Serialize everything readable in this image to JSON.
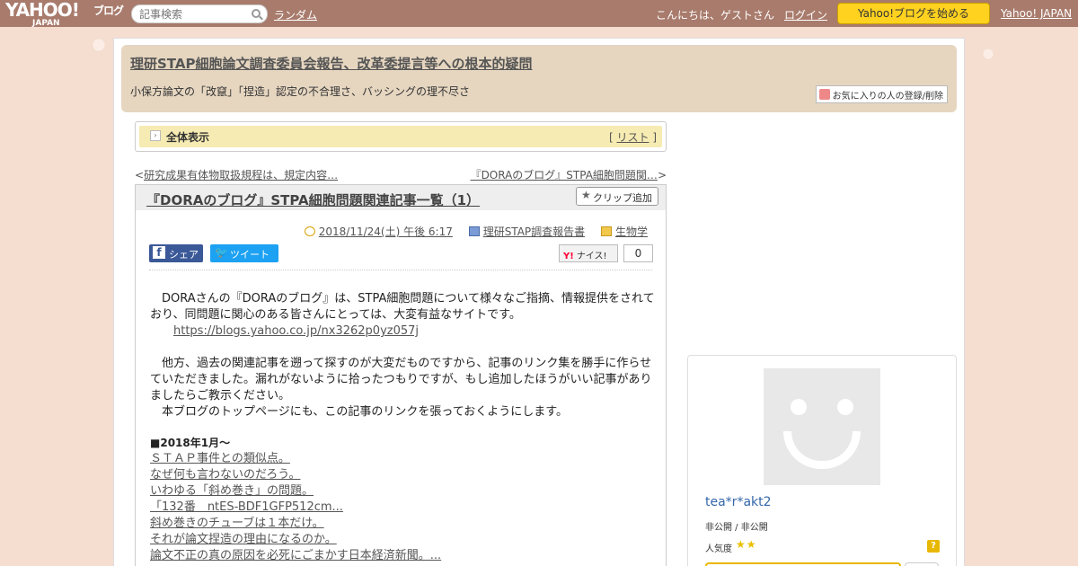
{
  "topbar": {
    "logo_text": "YAHOO!",
    "logo_sub": "JAPAN",
    "logo_blog": "ブログ",
    "search_placeholder": "記事検索",
    "random_label": "ランダム",
    "greeting": "こんにちは、ゲストさん",
    "login_label": "ログイン",
    "start_button": "Yahoo!ブログを始める",
    "yahoo_japan_link": "Yahoo! JAPAN",
    "bar_color": "#a87b6c",
    "start_button_color": "#ffd21f"
  },
  "blog": {
    "title": "理研STAP細胞論文調査委員会報告、改革委提言等への根本的疑問",
    "description": "小保方論文の「改竄」「捏造」認定の不合理さ、バッシングの理不尽さ",
    "favorite_button": "お気に入りの人の登録/削除"
  },
  "section": {
    "label": "全体表示",
    "list_open": "[ ",
    "list_link": "リスト",
    "list_close": " ]"
  },
  "nav": {
    "prev_arrow": "<",
    "prev_label": "研究成果有体物取扱規程は、規定内容…",
    "next_label": "『DORAのブログ』STPA細胞問題関…",
    "next_arrow": ">"
  },
  "article": {
    "title": "『DORAのブログ』STPA細胞問題関連記事一覧（1）",
    "clip_button": "クリップ追加",
    "date": "2018/11/24(土) 午後 6:17",
    "category1": "理研STAP調査報告書",
    "category2": "生物学",
    "share_label": "シェア",
    "tweet_label": "ツイート",
    "nice_label": "ナイス!",
    "nice_count": "0",
    "paragraph1": "DORAさんの『DORAのブログ』は、STPA細胞問題について様々なご指摘、情報提供をされており、同問題に関心のある皆さんにとっては、大変有益なサイトです。",
    "url": "https://blogs.yahoo.co.jp/nx3262p0yz057j",
    "paragraph2": "他方、過去の関連記事を遡って探すのが大変だものですから、記事のリンク集を勝手に作らせていただきました。漏れがないように拾ったつもりですが、もし追加したほうがいい記事がありましたらご教示ください。",
    "paragraph3": "本ブログのトップページにも、この記事のリンクを張っておくようにします。",
    "heading": "■2018年1月～",
    "links": [
      "ＳＴＡＰ事件との類似点。",
      "なぜ何も言わないのだろう。",
      "いわゆる「斜め巻き」の問題。",
      "「132番　ntES-BDF1GFP512cm...",
      "斜め巻きのチューブは１本だけ。",
      "それが論文捏造の理由になるのか。",
      "論文不正の真の原因を必死にごまかす日本経済新聞。..."
    ]
  },
  "profile": {
    "name": "tea*r*akt2",
    "privacy": "非公開 / 非公開",
    "popularity_label": "人気度",
    "popularity_stars": "★★",
    "help": "?"
  }
}
